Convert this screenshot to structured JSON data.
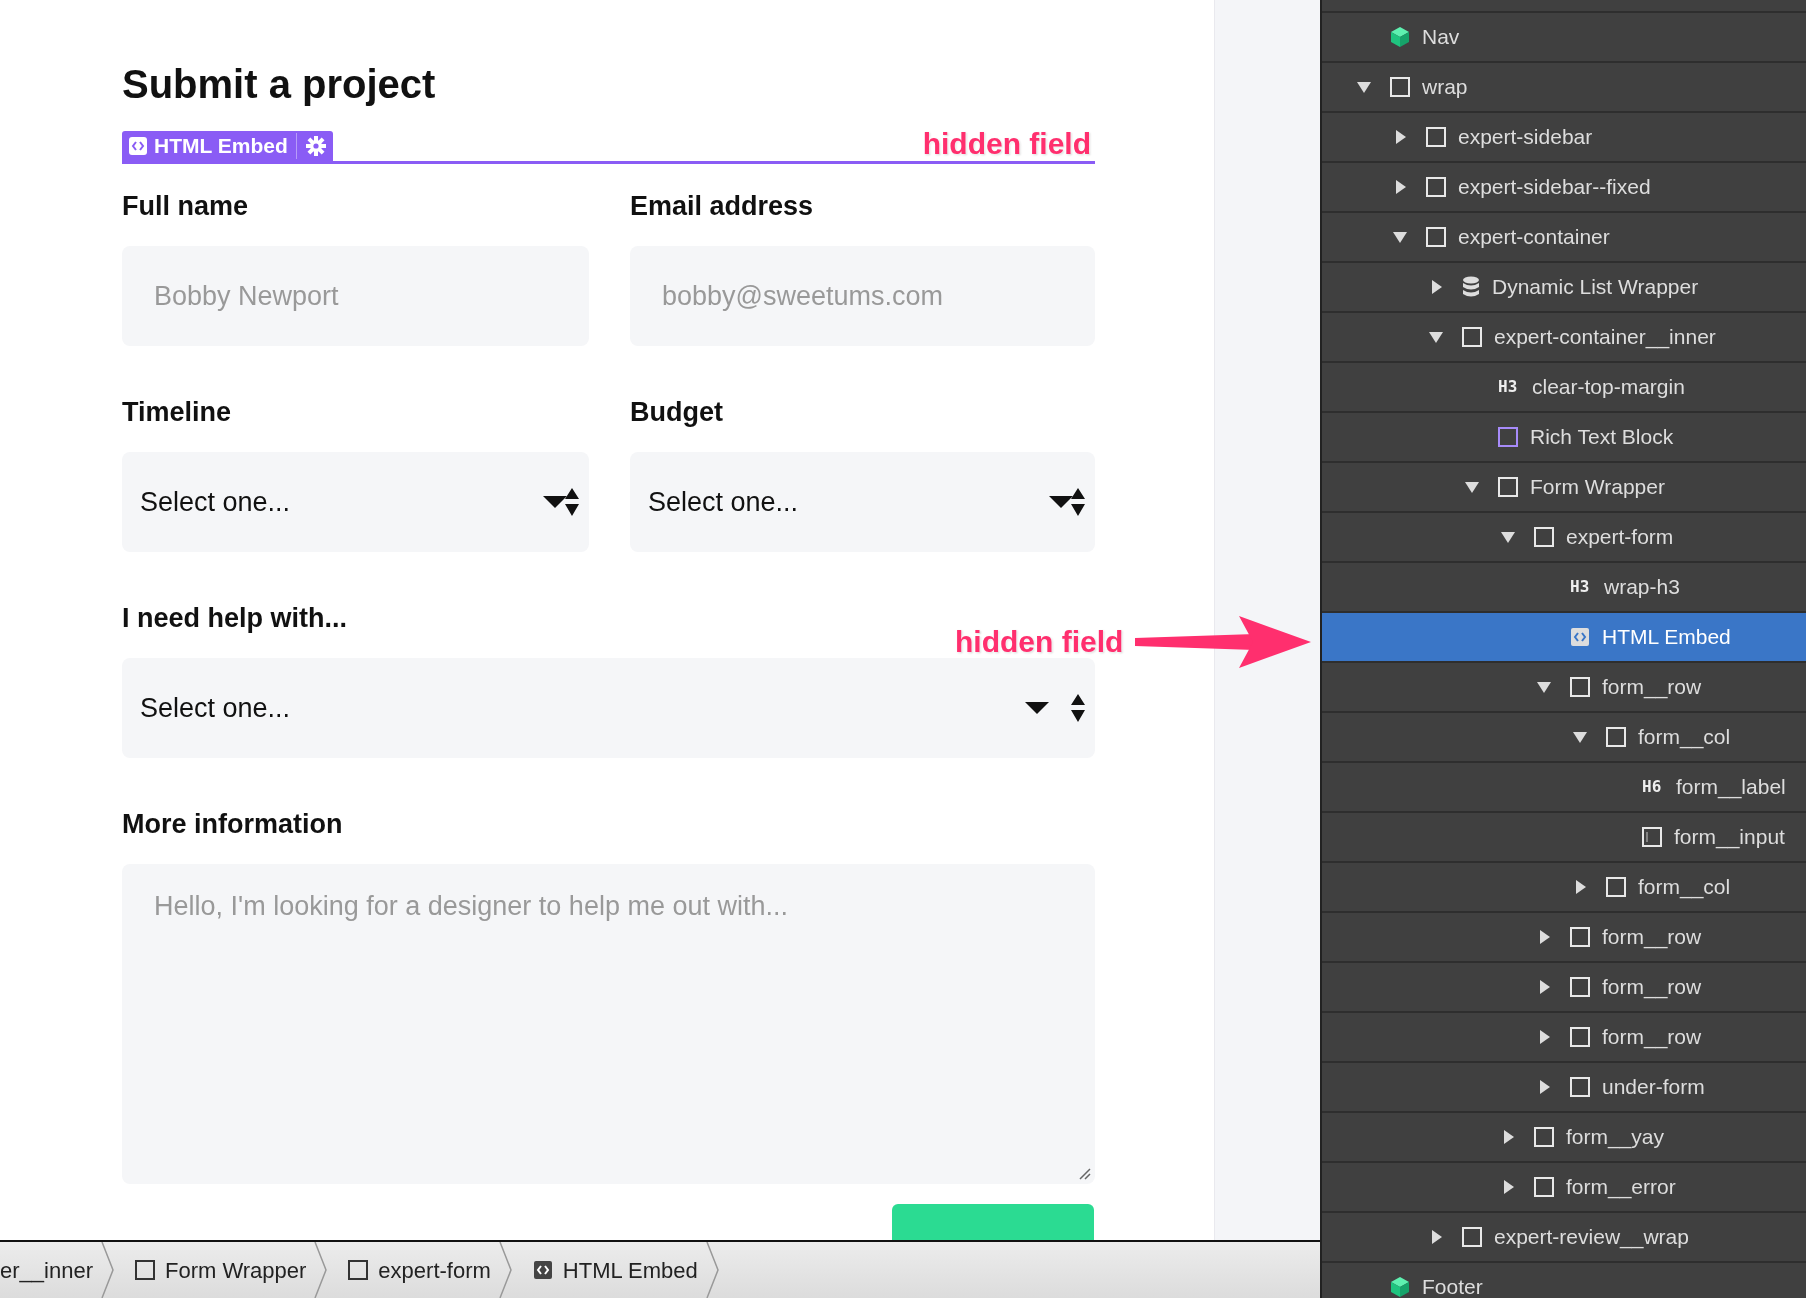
{
  "canvas": {
    "heading": "Submit a project",
    "embed_tag": {
      "label": "HTML Embed"
    },
    "annotations": [
      {
        "text": "hidden field"
      },
      {
        "text": "hidden field"
      }
    ],
    "fields": [
      {
        "kind": "text",
        "label": "Full name",
        "placeholder": "Bobby Newport"
      },
      {
        "kind": "text",
        "label": "Email address",
        "placeholder": "bobby@sweetums.com"
      },
      {
        "kind": "select",
        "label": "Timeline",
        "value": "Select one..."
      },
      {
        "kind": "select",
        "label": "Budget",
        "value": "Select one..."
      },
      {
        "kind": "select-wide",
        "label": "I need help with...",
        "value": "Select one..."
      },
      {
        "kind": "textarea",
        "label": "More information",
        "placeholder": "Hello, I'm looking for a designer to help me out with..."
      }
    ]
  },
  "breadcrumb": [
    {
      "label": "er__inner",
      "kind": "none"
    },
    {
      "label": "Form Wrapper",
      "kind": "box"
    },
    {
      "label": "expert-form",
      "kind": "box"
    },
    {
      "label": "HTML Embed",
      "kind": "embed"
    }
  ],
  "navigator": [
    {
      "label": "Nav",
      "kind": "symbol",
      "selected": false
    },
    {
      "label": "wrap",
      "kind": "box",
      "selected": false,
      "expanded": true,
      "children": [
        {
          "label": "expert-sidebar",
          "kind": "box",
          "selected": false,
          "expanded": false
        },
        {
          "label": "expert-sidebar--fixed",
          "kind": "box",
          "selected": false,
          "expanded": false
        },
        {
          "label": "expert-container",
          "kind": "box",
          "selected": false,
          "expanded": true,
          "children": [
            {
              "label": "Dynamic List Wrapper",
              "kind": "database",
              "selected": false,
              "expanded": false
            },
            {
              "label": "expert-container__inner",
              "kind": "box",
              "selected": false,
              "expanded": true,
              "children": [
                {
                  "label": "clear-top-margin",
                  "kind": "heading",
                  "tag": "H3",
                  "selected": false
                },
                {
                  "label": "Rich Text Block",
                  "kind": "richtext",
                  "selected": false
                },
                {
                  "label": "Form Wrapper",
                  "kind": "box",
                  "selected": false,
                  "expanded": true,
                  "children": [
                    {
                      "label": "expert-form",
                      "kind": "box",
                      "selected": false,
                      "expanded": true,
                      "children": [
                        {
                          "label": "wrap-h3",
                          "kind": "heading",
                          "tag": "H3",
                          "selected": false
                        },
                        {
                          "label": "HTML Embed",
                          "kind": "embed",
                          "selected": true
                        },
                        {
                          "label": "form__row",
                          "kind": "box",
                          "selected": false,
                          "expanded": true,
                          "children": [
                            {
                              "label": "form__col",
                              "kind": "box",
                              "selected": false,
                              "expanded": true,
                              "children": [
                                {
                                  "label": "form__label",
                                  "kind": "heading",
                                  "tag": "H6",
                                  "selected": false
                                },
                                {
                                  "label": "form__input",
                                  "kind": "input",
                                  "selected": false
                                }
                              ]
                            },
                            {
                              "label": "form__col",
                              "kind": "box",
                              "selected": false,
                              "expanded": false
                            }
                          ]
                        },
                        {
                          "label": "form__row",
                          "kind": "box",
                          "selected": false,
                          "expanded": false
                        },
                        {
                          "label": "form__row",
                          "kind": "box",
                          "selected": false,
                          "expanded": false
                        },
                        {
                          "label": "form__row",
                          "kind": "box",
                          "selected": false,
                          "expanded": false
                        },
                        {
                          "label": "under-form",
                          "kind": "box",
                          "selected": false,
                          "expanded": false
                        }
                      ]
                    },
                    {
                      "label": "form__yay",
                      "kind": "box",
                      "selected": false,
                      "expanded": false
                    },
                    {
                      "label": "form__error",
                      "kind": "box",
                      "selected": false,
                      "expanded": false
                    }
                  ]
                }
              ]
            },
            {
              "label": "expert-review__wrap",
              "kind": "box",
              "selected": false,
              "expanded": false
            }
          ]
        }
      ]
    },
    {
      "label": "Footer",
      "kind": "symbol",
      "selected": false
    }
  ]
}
